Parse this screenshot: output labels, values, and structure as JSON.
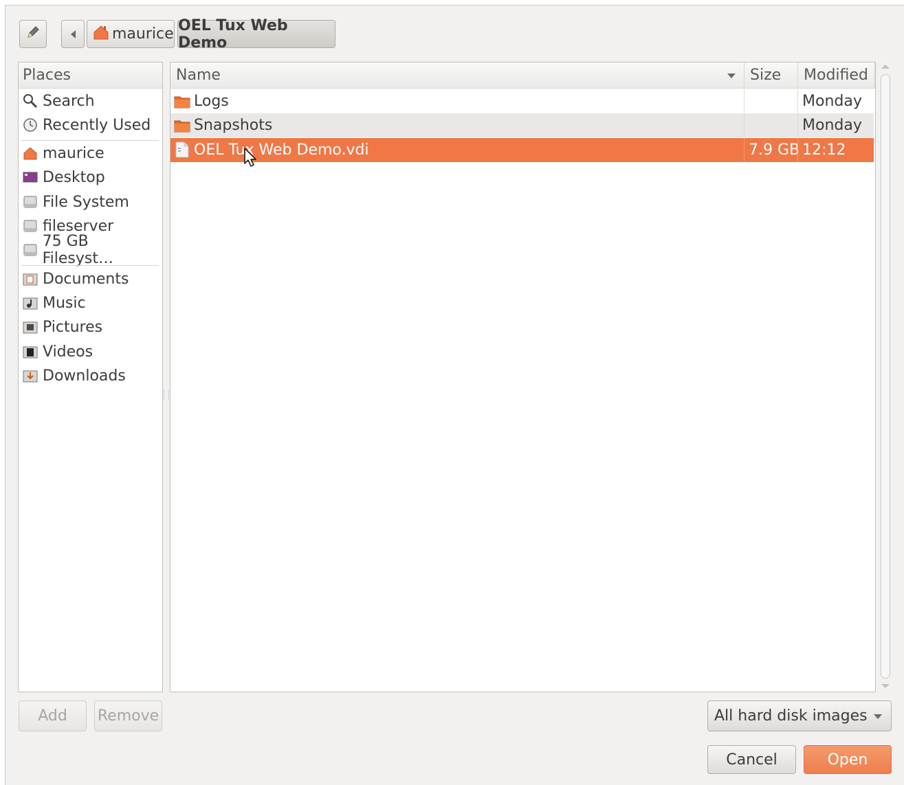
{
  "toolbar": {
    "breadcrumbs": [
      "maurice",
      "OEL Tux Web Demo"
    ]
  },
  "places": {
    "header": "Places",
    "items": [
      {
        "label": "Search",
        "icon": "search-icon"
      },
      {
        "label": "Recently Used",
        "icon": "recent-icon"
      },
      {
        "label": "maurice",
        "icon": "home-folder-icon"
      },
      {
        "label": "Desktop",
        "icon": "desktop-icon"
      },
      {
        "label": "File System",
        "icon": "drive-icon"
      },
      {
        "label": "fileserver",
        "icon": "drive-icon"
      },
      {
        "label": "75 GB Filesyst…",
        "icon": "drive-icon"
      },
      {
        "label": "Documents",
        "icon": "documents-folder-icon"
      },
      {
        "label": "Music",
        "icon": "music-folder-icon"
      },
      {
        "label": "Pictures",
        "icon": "pictures-folder-icon"
      },
      {
        "label": "Videos",
        "icon": "videos-folder-icon"
      },
      {
        "label": "Downloads",
        "icon": "downloads-folder-icon"
      }
    ]
  },
  "file_list": {
    "columns": {
      "name": "Name",
      "size": "Size",
      "modified": "Modified"
    },
    "rows": [
      {
        "name": "Logs",
        "size": "",
        "modified": "Monday",
        "icon": "folder-icon"
      },
      {
        "name": "Snapshots",
        "size": "",
        "modified": "Monday",
        "icon": "folder-icon"
      },
      {
        "name": "OEL Tux Web Demo.vdi",
        "size": "7.9 GB",
        "modified": "12:12",
        "icon": "file-icon",
        "selected": true
      }
    ]
  },
  "actions": {
    "add": "Add",
    "remove": "Remove",
    "filter": "All hard disk images",
    "cancel": "Cancel",
    "open": "Open"
  },
  "colors": {
    "selection": "#f07746",
    "accent_orange": "#ee7f4e"
  }
}
